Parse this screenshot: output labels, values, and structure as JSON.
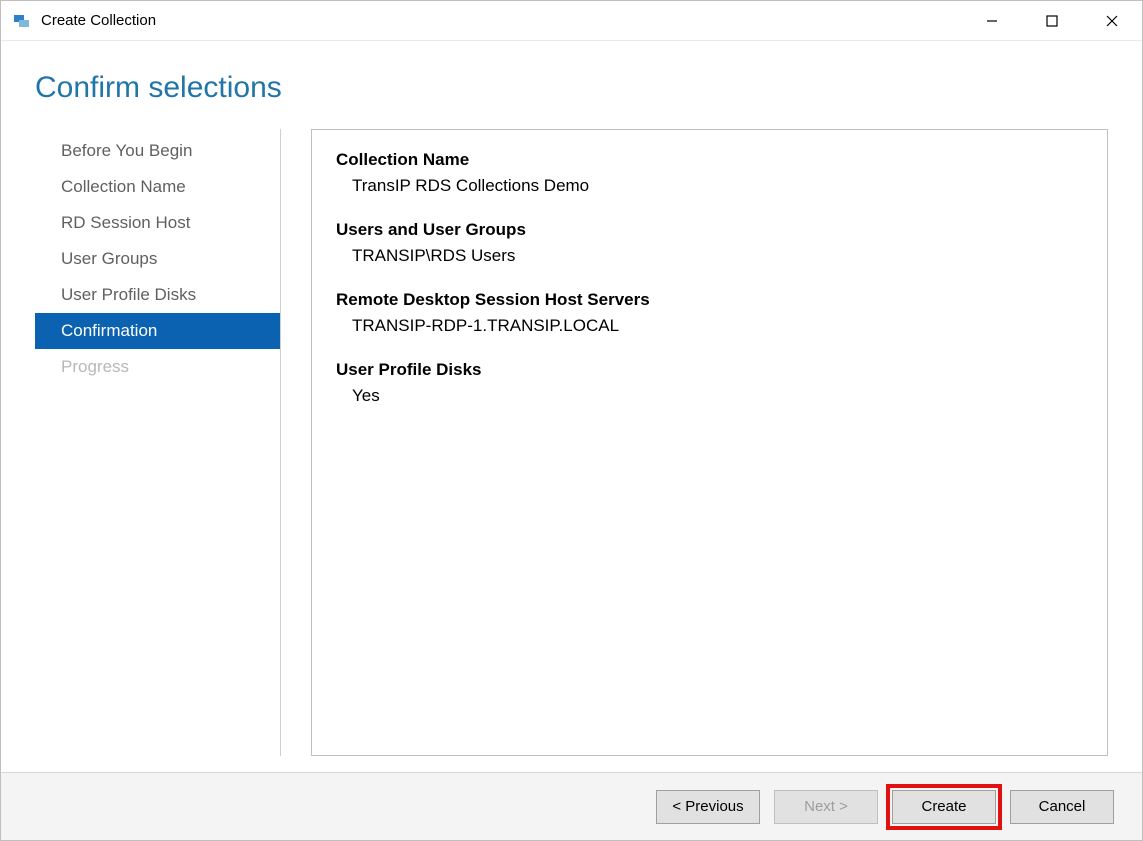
{
  "window": {
    "title": "Create Collection"
  },
  "page": {
    "title": "Confirm selections"
  },
  "nav": {
    "items": [
      {
        "label": "Before You Begin",
        "state": "normal"
      },
      {
        "label": "Collection Name",
        "state": "normal"
      },
      {
        "label": "RD Session Host",
        "state": "normal"
      },
      {
        "label": "User Groups",
        "state": "normal"
      },
      {
        "label": "User Profile Disks",
        "state": "normal"
      },
      {
        "label": "Confirmation",
        "state": "active"
      },
      {
        "label": "Progress",
        "state": "disabled"
      }
    ]
  },
  "summary": {
    "collection_name_label": "Collection Name",
    "collection_name_value": "TransIP RDS Collections Demo",
    "users_groups_label": "Users and User Groups",
    "users_groups_value": "TRANSIP\\RDS Users",
    "rdsh_label": "Remote Desktop Session Host Servers",
    "rdsh_value": "TRANSIP-RDP-1.TRANSIP.LOCAL",
    "upd_label": "User Profile Disks",
    "upd_value": "Yes"
  },
  "buttons": {
    "previous": "< Previous",
    "next": "Next >",
    "create": "Create",
    "cancel": "Cancel"
  }
}
